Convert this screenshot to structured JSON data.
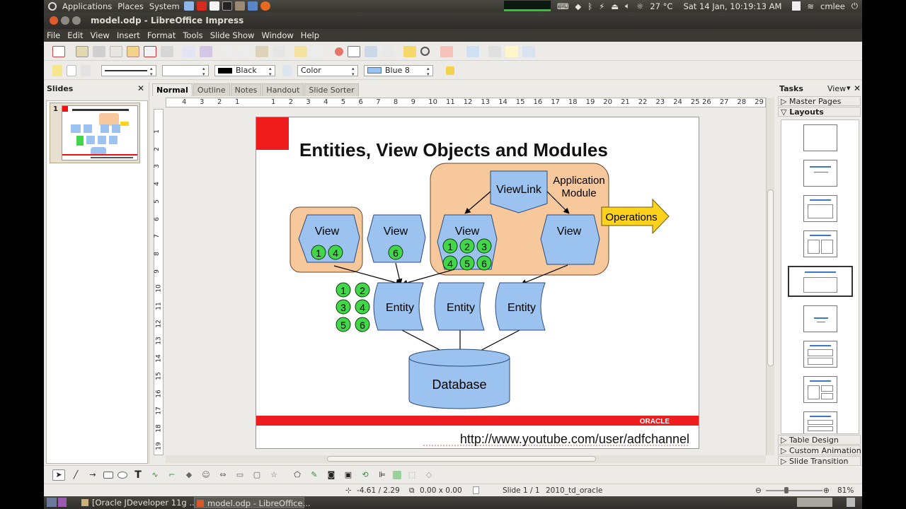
{
  "system_panel": {
    "menus": [
      "Applications",
      "Places",
      "System"
    ],
    "temperature": "27 °C",
    "datetime": "Sat 14 Jan, 10:19:13 AM",
    "user": "cmlee"
  },
  "window": {
    "title": "model.odp - LibreOffice Impress"
  },
  "menubar": [
    "File",
    "Edit",
    "View",
    "Insert",
    "Format",
    "Tools",
    "Slide Show",
    "Window",
    "Help"
  ],
  "line_toolbar": {
    "line_color": "Black",
    "area_style": "Color",
    "area_color": "Blue 8"
  },
  "slides_pane": {
    "title": "Slides",
    "slide_number": "1"
  },
  "view_tabs": [
    "Normal",
    "Outline",
    "Notes",
    "Handout",
    "Slide Sorter"
  ],
  "ruler": {
    "left_labels": [
      "4",
      "3",
      "2",
      "1"
    ],
    "labels": [
      "1",
      "2",
      "3",
      "4",
      "5",
      "6",
      "7",
      "8",
      "9",
      "10",
      "11",
      "12",
      "13",
      "14",
      "15",
      "16",
      "17",
      "18",
      "19",
      "20",
      "21",
      "22",
      "23",
      "24",
      "25"
    ],
    "right_labels": [
      "26",
      "27",
      "28",
      "29",
      "3"
    ]
  },
  "vruler_labels": [
    "1",
    "2",
    "3",
    "4",
    "5",
    "6",
    "7",
    "8",
    "9",
    "10",
    "11",
    "12",
    "13",
    "14",
    "15",
    "16",
    "17",
    "18",
    "19"
  ],
  "slide": {
    "title": "Entities, View Objects and Modules",
    "app_module_label": [
      "Application",
      "Module"
    ],
    "viewlink": "ViewLink",
    "operations": "Operations",
    "view_label": "View",
    "entity_label": "Entity",
    "database_label": "Database",
    "footer_brand": "ORACLE",
    "footer_url": "http://www.youtube.com/user/adfchannel",
    "views": [
      {
        "numbers": [
          "1",
          "4"
        ]
      },
      {
        "numbers": [
          "6"
        ]
      },
      {
        "numbers": [
          "1",
          "2",
          "3",
          "4",
          "5",
          "6"
        ]
      },
      {
        "numbers": []
      }
    ],
    "loose_numbers": [
      "1",
      "2",
      "3",
      "4",
      "5",
      "6"
    ],
    "colors": {
      "box_fill": "#9cc3f0",
      "module_fill": "#f7c89c",
      "circle_fill": "#43d64b",
      "operations_fill": "#fcd21c",
      "brand_red": "#ee1c1c"
    }
  },
  "tasks_pane": {
    "title": "Tasks",
    "view_menu": "View",
    "sections_top": [
      "Master Pages",
      "Layouts"
    ],
    "sections_bottom": [
      "Table Design",
      "Custom Animation",
      "Slide Transition"
    ]
  },
  "status_bar": {
    "position": "-4.61 / 2.29",
    "size": "0.00 x 0.00",
    "slide_indicator": "Slide 1 / 1",
    "master": "2010_td_oracle",
    "zoom": "81%"
  },
  "taskbar": {
    "items": [
      "[Oracle JDeveloper 11g ...",
      "model.odp - LibreOffice..."
    ]
  }
}
